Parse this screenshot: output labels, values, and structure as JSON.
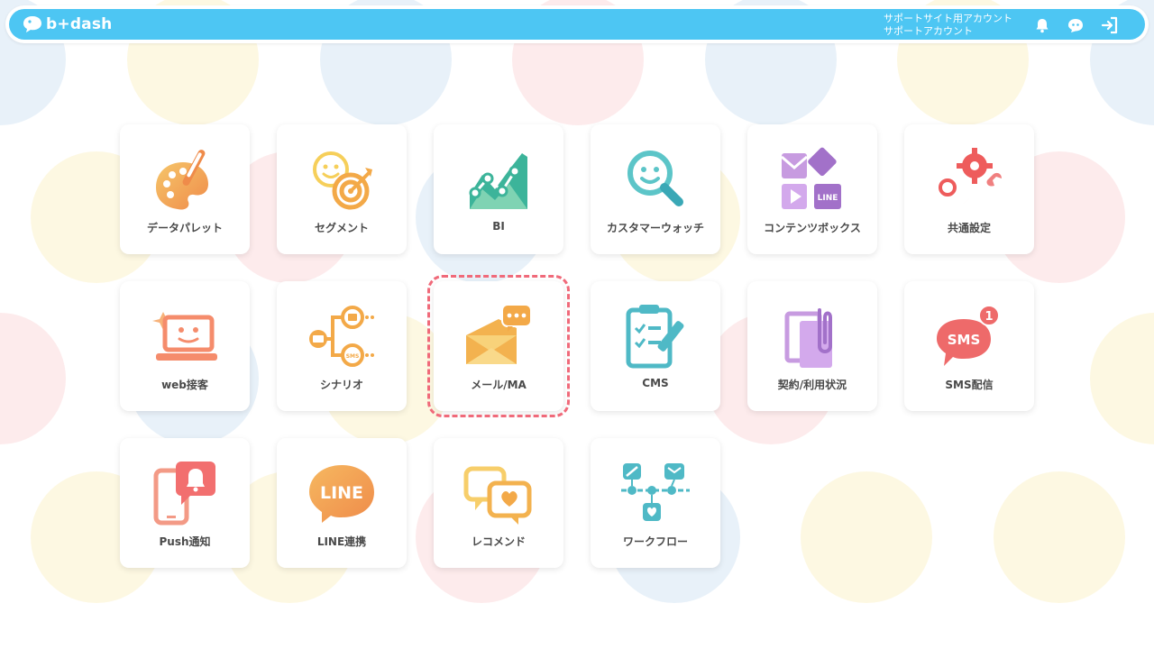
{
  "header": {
    "logo_text": "b+dash",
    "account_line1": "サポートサイト用アカウント",
    "account_line2": "サポートアカウント",
    "icons": [
      "bell-icon",
      "chat-bot-icon",
      "logout-icon"
    ]
  },
  "colors": {
    "header_bg": "#4dc6f3",
    "selected_outline": "#f06a7a",
    "label_text": "#4a4a4a"
  },
  "tiles": [
    {
      "label": "データパレット",
      "icon": "palette-icon"
    },
    {
      "label": "セグメント",
      "icon": "segment-target-icon"
    },
    {
      "label": "BI",
      "icon": "bi-chart-icon"
    },
    {
      "label": "カスタマーウォッチ",
      "icon": "magnifier-face-icon"
    },
    {
      "label": "コンテンツボックス",
      "icon": "content-box-icon"
    },
    {
      "label": "共通設定",
      "icon": "gear-wrench-icon"
    },
    {
      "label": "web接客",
      "icon": "laptop-face-icon"
    },
    {
      "label": "シナリオ",
      "icon": "scenario-flow-icon"
    },
    {
      "label": "メール/MA",
      "icon": "mail-envelope-icon",
      "selected": true
    },
    {
      "label": "CMS",
      "icon": "clipboard-pen-icon"
    },
    {
      "label": "契約/利用状況",
      "icon": "contract-clip-icon"
    },
    {
      "label": "SMS配信",
      "icon": "sms-bubble-icon",
      "badge": "1"
    },
    {
      "label": "Push通知",
      "icon": "phone-bell-icon"
    },
    {
      "label": "LINE連携",
      "icon": "line-bubble-icon"
    },
    {
      "label": "レコメンド",
      "icon": "recommend-heart-icon"
    },
    {
      "label": "ワークフロー",
      "icon": "workflow-icon"
    }
  ]
}
